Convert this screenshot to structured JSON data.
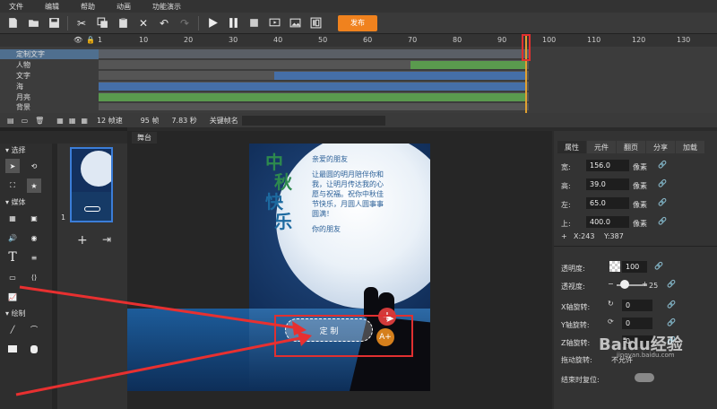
{
  "menu": [
    "文件",
    "编辑",
    "帮助",
    "动画",
    "功能演示"
  ],
  "toolbar": {
    "publish_label": "发布"
  },
  "timeline": {
    "ruler": [
      "1",
      "10",
      "20",
      "30",
      "40",
      "50",
      "60",
      "70",
      "80",
      "90",
      "100",
      "110",
      "120",
      "130"
    ],
    "layers": [
      "定制文字",
      "人物",
      "文字",
      "海",
      "月亮",
      "背景"
    ],
    "status": {
      "frame_rate": "12 帧速",
      "frames": "95 帧",
      "seconds": "7.83 秒",
      "keyframe_label": "关键帧名"
    }
  },
  "left_tools": {
    "select_section": "选择",
    "media_section": "媒体",
    "draw_section": "绘制"
  },
  "thumbs": {
    "page_number": "1"
  },
  "stage": {
    "tab": "舞台",
    "title_chars": [
      "中",
      "秋",
      "快",
      "乐"
    ],
    "letter": {
      "greeting": "亲爱的朋友",
      "body": "让最圆的明月陪伴你和我，让明月传达我的心愿与祝福。祝你中秋佳节快乐，月圆人圆事事圆满！",
      "sign": "你的朋友"
    },
    "button_label": "定  制"
  },
  "right_panel": {
    "tabs": [
      "属性",
      "元件",
      "翻页",
      "分享",
      "加载"
    ],
    "props": [
      {
        "label": "宽:",
        "value": "156.0",
        "unit": "像素"
      },
      {
        "label": "高:",
        "value": "39.0",
        "unit": "像素"
      },
      {
        "label": "左:",
        "value": "65.0",
        "unit": "像素"
      },
      {
        "label": "上:",
        "value": "400.0",
        "unit": "像素"
      }
    ],
    "coord": {
      "x": "X:243",
      "y": "Y:387"
    },
    "opacity_label": "透明度:",
    "opacity_value": "100",
    "transparency_label": "透视度:",
    "transparency_value": "25",
    "x_rot_label": "X轴旋转:",
    "x_rot_value": "0",
    "y_rot_label": "Y轴旋转:",
    "y_rot_value": "0",
    "z_rot_label": "Z轴旋转:",
    "z_rot_value": "0",
    "drag_label": "拖动旋转:",
    "drag_value": "不允许",
    "reset_label": "结束时复位:",
    "watermark": "Baidu经验",
    "watermark_url": "jingyan.baidu.com"
  },
  "colors": {
    "accent": "#f0821e",
    "highlight": "#e03030",
    "moon_bg": "#0f2a57"
  }
}
